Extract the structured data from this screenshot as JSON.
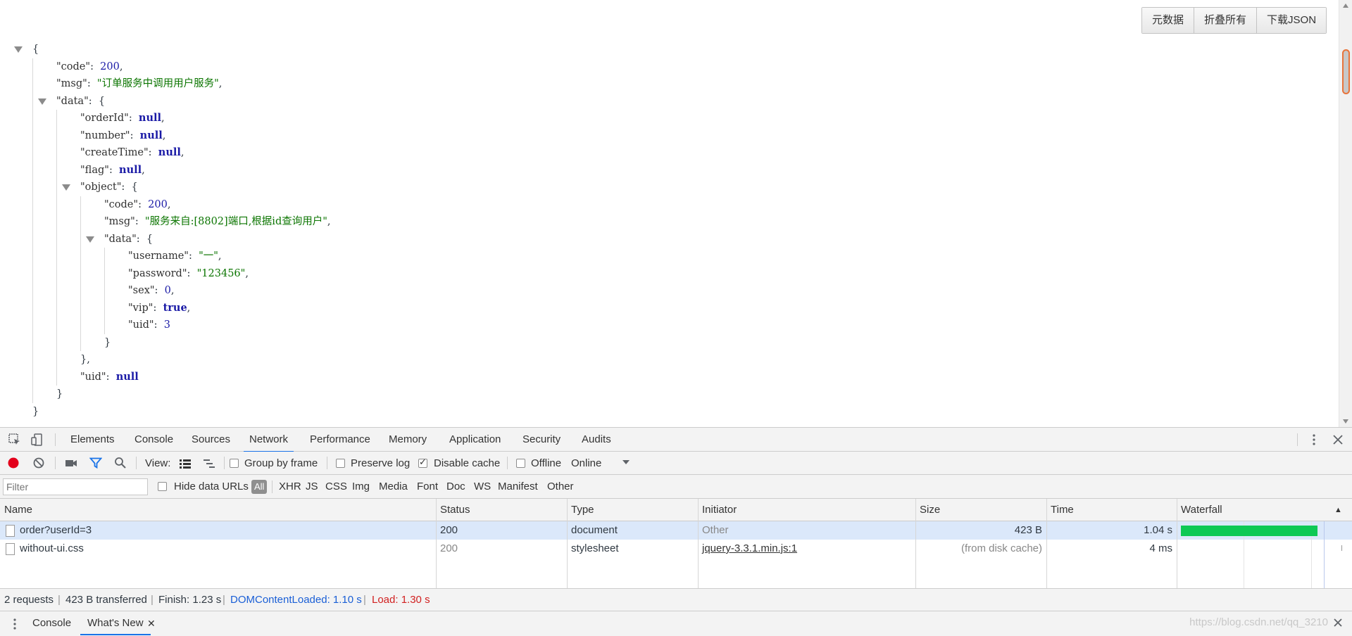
{
  "viewer": {
    "buttons": [
      "元数据",
      "折叠所有",
      "下载JSON"
    ],
    "json_lines": [
      {
        "indent": 0,
        "toggle": true,
        "parts": [
          {
            "t": "{",
            "c": "p"
          }
        ]
      },
      {
        "indent": 1,
        "parts": [
          {
            "t": "\"code\"",
            "c": "key"
          },
          {
            "t": ":  ",
            "c": "p"
          },
          {
            "t": "200",
            "c": "num"
          },
          {
            "t": ",",
            "c": "p"
          }
        ]
      },
      {
        "indent": 1,
        "parts": [
          {
            "t": "\"msg\"",
            "c": "key"
          },
          {
            "t": ":  ",
            "c": "p"
          },
          {
            "t": "\"订单服务中调用用户服务\"",
            "c": "str"
          },
          {
            "t": ",",
            "c": "p"
          }
        ]
      },
      {
        "indent": 1,
        "toggle": true,
        "parts": [
          {
            "t": "\"data\"",
            "c": "key"
          },
          {
            "t": ":  {",
            "c": "p"
          }
        ]
      },
      {
        "indent": 2,
        "parts": [
          {
            "t": "\"orderId\"",
            "c": "key"
          },
          {
            "t": ":  ",
            "c": "p"
          },
          {
            "t": "null",
            "c": "nul"
          },
          {
            "t": ",",
            "c": "p"
          }
        ]
      },
      {
        "indent": 2,
        "parts": [
          {
            "t": "\"number\"",
            "c": "key"
          },
          {
            "t": ":  ",
            "c": "p"
          },
          {
            "t": "null",
            "c": "nul"
          },
          {
            "t": ",",
            "c": "p"
          }
        ]
      },
      {
        "indent": 2,
        "parts": [
          {
            "t": "\"createTime\"",
            "c": "key"
          },
          {
            "t": ":  ",
            "c": "p"
          },
          {
            "t": "null",
            "c": "nul"
          },
          {
            "t": ",",
            "c": "p"
          }
        ]
      },
      {
        "indent": 2,
        "parts": [
          {
            "t": "\"flag\"",
            "c": "key"
          },
          {
            "t": ":  ",
            "c": "p"
          },
          {
            "t": "null",
            "c": "nul"
          },
          {
            "t": ",",
            "c": "p"
          }
        ]
      },
      {
        "indent": 2,
        "toggle": true,
        "parts": [
          {
            "t": "\"object\"",
            "c": "key"
          },
          {
            "t": ":  {",
            "c": "p"
          }
        ]
      },
      {
        "indent": 3,
        "parts": [
          {
            "t": "\"code\"",
            "c": "key"
          },
          {
            "t": ":  ",
            "c": "p"
          },
          {
            "t": "200",
            "c": "num"
          },
          {
            "t": ",",
            "c": "p"
          }
        ]
      },
      {
        "indent": 3,
        "parts": [
          {
            "t": "\"msg\"",
            "c": "key"
          },
          {
            "t": ":  ",
            "c": "p"
          },
          {
            "t": "\"服务来自:[8802]端口,根据id查询用户\"",
            "c": "str"
          },
          {
            "t": ",",
            "c": "p"
          }
        ]
      },
      {
        "indent": 3,
        "toggle": true,
        "parts": [
          {
            "t": "\"data\"",
            "c": "key"
          },
          {
            "t": ":  {",
            "c": "p"
          }
        ]
      },
      {
        "indent": 4,
        "parts": [
          {
            "t": "\"username\"",
            "c": "key"
          },
          {
            "t": ":  ",
            "c": "p"
          },
          {
            "t": "\"一\"",
            "c": "str"
          },
          {
            "t": ",",
            "c": "p"
          }
        ]
      },
      {
        "indent": 4,
        "parts": [
          {
            "t": "\"password\"",
            "c": "key"
          },
          {
            "t": ":  ",
            "c": "p"
          },
          {
            "t": "\"123456\"",
            "c": "str"
          },
          {
            "t": ",",
            "c": "p"
          }
        ]
      },
      {
        "indent": 4,
        "parts": [
          {
            "t": "\"sex\"",
            "c": "key"
          },
          {
            "t": ":  ",
            "c": "p"
          },
          {
            "t": "0",
            "c": "num"
          },
          {
            "t": ",",
            "c": "p"
          }
        ]
      },
      {
        "indent": 4,
        "parts": [
          {
            "t": "\"vip\"",
            "c": "key"
          },
          {
            "t": ":  ",
            "c": "p"
          },
          {
            "t": "true",
            "c": "bool"
          },
          {
            "t": ",",
            "c": "p"
          }
        ]
      },
      {
        "indent": 4,
        "parts": [
          {
            "t": "\"uid\"",
            "c": "key"
          },
          {
            "t": ":  ",
            "c": "p"
          },
          {
            "t": "3",
            "c": "num"
          }
        ]
      },
      {
        "indent": 3,
        "parts": [
          {
            "t": "}",
            "c": "p"
          }
        ]
      },
      {
        "indent": 2,
        "parts": [
          {
            "t": "},",
            "c": "p"
          }
        ]
      },
      {
        "indent": 2,
        "parts": [
          {
            "t": "\"uid\"",
            "c": "key"
          },
          {
            "t": ":  ",
            "c": "p"
          },
          {
            "t": "null",
            "c": "nul"
          }
        ]
      },
      {
        "indent": 1,
        "parts": [
          {
            "t": "}",
            "c": "p"
          }
        ]
      },
      {
        "indent": 0,
        "parts": [
          {
            "t": "}",
            "c": "p"
          }
        ]
      }
    ]
  },
  "devtools": {
    "tabs": [
      "Elements",
      "Console",
      "Sources",
      "Network",
      "Performance",
      "Memory",
      "Application",
      "Security",
      "Audits"
    ],
    "active_tab": "Network",
    "toolbar": {
      "view_label": "View:",
      "group_by_frame": "Group by frame",
      "preserve_log": "Preserve log",
      "disable_cache": "Disable cache",
      "offline": "Offline",
      "throttle": "Online"
    },
    "filter": {
      "placeholder": "Filter",
      "hide_data_urls": "Hide data URLs",
      "types": [
        "All",
        "XHR",
        "JS",
        "CSS",
        "Img",
        "Media",
        "Font",
        "Doc",
        "WS",
        "Manifest",
        "Other"
      ]
    },
    "columns": [
      "Name",
      "Status",
      "Type",
      "Initiator",
      "Size",
      "Time",
      "Waterfall"
    ],
    "rows": [
      {
        "name": "order?userId=3",
        "status": "200",
        "type": "document",
        "initiator": "Other",
        "size": "423 B",
        "time": "1.04 s"
      },
      {
        "name": "without-ui.css",
        "status": "200",
        "type": "stylesheet",
        "initiator": "jquery-3.3.1.min.js:1",
        "size": "(from disk cache)",
        "time": "4 ms"
      }
    ],
    "status": {
      "requests": "2 requests",
      "transferred": "423 B transferred",
      "finish": "Finish: 1.23 s",
      "dcl": "DOMContentLoaded: 1.10 s",
      "load": "Load: 1.30 s"
    },
    "drawer_tabs": [
      "Console",
      "What's New"
    ],
    "watermark": "https://blog.csdn.net/qq_3210"
  },
  "colors": {
    "accent": "#1a73e8",
    "waterfall": "#0ec955",
    "record": "#e3001b"
  }
}
